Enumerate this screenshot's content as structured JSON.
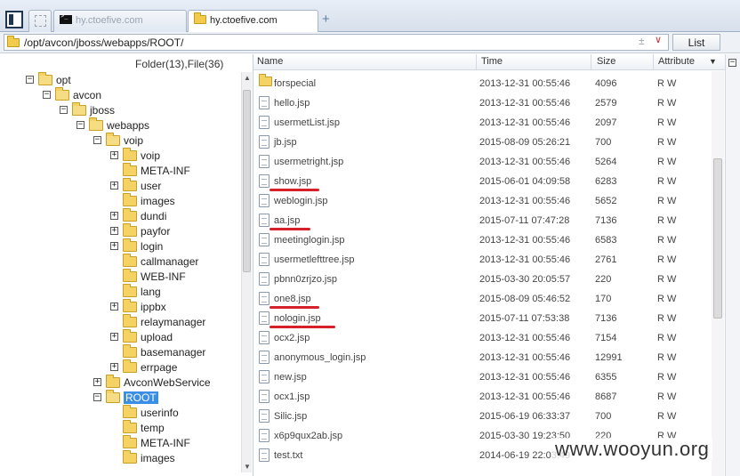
{
  "tabs": [
    {
      "label": "",
      "icon": "blank-page-icon"
    },
    {
      "label": "hy.ctoefive.com",
      "icon": "terminal-icon"
    },
    {
      "label": "hy.ctoefive.com",
      "icon": "folder-icon",
      "active": true
    }
  ],
  "new_tab_label": "+",
  "address": {
    "path": "/opt/avcon/jboss/webapps/ROOT/",
    "clear_glyph": "±",
    "dropdown_glyph": "∨"
  },
  "list_button": "List",
  "tree": {
    "header": "Folder(13),File(36)",
    "nodes": [
      {
        "label": "opt",
        "depth": 0,
        "state": "open"
      },
      {
        "label": "avcon",
        "depth": 1,
        "state": "open"
      },
      {
        "label": "jboss",
        "depth": 2,
        "state": "open"
      },
      {
        "label": "webapps",
        "depth": 3,
        "state": "open"
      },
      {
        "label": "voip",
        "depth": 4,
        "state": "open"
      },
      {
        "label": "voip",
        "depth": 5,
        "state": "closed"
      },
      {
        "label": "META-INF",
        "depth": 5,
        "state": "leaf"
      },
      {
        "label": "user",
        "depth": 5,
        "state": "closed"
      },
      {
        "label": "images",
        "depth": 5,
        "state": "leaf"
      },
      {
        "label": "dundi",
        "depth": 5,
        "state": "closed"
      },
      {
        "label": "payfor",
        "depth": 5,
        "state": "closed"
      },
      {
        "label": "login",
        "depth": 5,
        "state": "closed"
      },
      {
        "label": "callmanager",
        "depth": 5,
        "state": "leaf"
      },
      {
        "label": "WEB-INF",
        "depth": 5,
        "state": "leaf"
      },
      {
        "label": "lang",
        "depth": 5,
        "state": "leaf"
      },
      {
        "label": "ippbx",
        "depth": 5,
        "state": "closed"
      },
      {
        "label": "relaymanager",
        "depth": 5,
        "state": "leaf"
      },
      {
        "label": "upload",
        "depth": 5,
        "state": "closed"
      },
      {
        "label": "basemanager",
        "depth": 5,
        "state": "leaf"
      },
      {
        "label": "errpage",
        "depth": 5,
        "state": "closed"
      },
      {
        "label": "AvconWebService",
        "depth": 4,
        "state": "closed"
      },
      {
        "label": "ROOT",
        "depth": 4,
        "state": "open",
        "selected": true
      },
      {
        "label": "userinfo",
        "depth": 5,
        "state": "leaf"
      },
      {
        "label": "temp",
        "depth": 5,
        "state": "leaf"
      },
      {
        "label": "META-INF",
        "depth": 5,
        "state": "leaf"
      },
      {
        "label": "images",
        "depth": 5,
        "state": "leaf"
      }
    ]
  },
  "columns": {
    "name": "Name",
    "time": "Time",
    "size": "Size",
    "attribute": "Attribute"
  },
  "files": [
    {
      "name": "forspecial",
      "time": "2013-12-31 00:55:46",
      "size": "4096",
      "attr": "R W",
      "type": "folder"
    },
    {
      "name": "hello.jsp",
      "time": "2013-12-31 00:55:46",
      "size": "2579",
      "attr": "R W",
      "type": "file"
    },
    {
      "name": "usermetList.jsp",
      "time": "2013-12-31 00:55:46",
      "size": "2097",
      "attr": "R W",
      "type": "file"
    },
    {
      "name": "jb.jsp",
      "time": "2015-08-09 05:26:21",
      "size": "700",
      "attr": "R W",
      "type": "file"
    },
    {
      "name": "usermetright.jsp",
      "time": "2013-12-31 00:55:46",
      "size": "5264",
      "attr": "R W",
      "type": "file"
    },
    {
      "name": "show.jsp",
      "time": "2015-06-01 04:09:58",
      "size": "6283",
      "attr": "R W",
      "type": "file",
      "highlight": true
    },
    {
      "name": "weblogin.jsp",
      "time": "2013-12-31 00:55:46",
      "size": "5652",
      "attr": "R W",
      "type": "file"
    },
    {
      "name": "aa.jsp",
      "time": "2015-07-11 07:47:28",
      "size": "7136",
      "attr": "R W",
      "type": "file",
      "highlight": true
    },
    {
      "name": "meetinglogin.jsp",
      "time": "2013-12-31 00:55:46",
      "size": "6583",
      "attr": "R W",
      "type": "file"
    },
    {
      "name": "usermetlefttree.jsp",
      "time": "2013-12-31 00:55:46",
      "size": "2761",
      "attr": "R W",
      "type": "file"
    },
    {
      "name": "pbnn0zrjzo.jsp",
      "time": "2015-03-30 20:05:57",
      "size": "220",
      "attr": "R W",
      "type": "file"
    },
    {
      "name": "one8.jsp",
      "time": "2015-08-09 05:46:52",
      "size": "170",
      "attr": "R W",
      "type": "file",
      "highlight": true
    },
    {
      "name": "nologin.jsp",
      "time": "2015-07-11 07:53:38",
      "size": "7136",
      "attr": "R W",
      "type": "file",
      "highlight": true
    },
    {
      "name": "ocx2.jsp",
      "time": "2013-12-31 00:55:46",
      "size": "7154",
      "attr": "R W",
      "type": "file"
    },
    {
      "name": "anonymous_login.jsp",
      "time": "2013-12-31 00:55:46",
      "size": "12991",
      "attr": "R W",
      "type": "file"
    },
    {
      "name": "new.jsp",
      "time": "2013-12-31 00:55:46",
      "size": "6355",
      "attr": "R W",
      "type": "file"
    },
    {
      "name": "ocx1.jsp",
      "time": "2013-12-31 00:55:46",
      "size": "8687",
      "attr": "R W",
      "type": "file"
    },
    {
      "name": "Silic.jsp",
      "time": "2015-06-19 06:33:37",
      "size": "700",
      "attr": "R W",
      "type": "file"
    },
    {
      "name": "x6p9qux2ab.jsp",
      "time": "2015-03-30 19:23:50",
      "size": "220",
      "attr": "R W",
      "type": "file"
    },
    {
      "name": "test.txt",
      "time": "2014-06-19 22:03:49",
      "size": "",
      "attr": "",
      "type": "file"
    }
  ],
  "watermark": "www.wooyun.org",
  "colors": {
    "highlight_underline": "#d6202a",
    "selection": "#3a8ee6"
  }
}
